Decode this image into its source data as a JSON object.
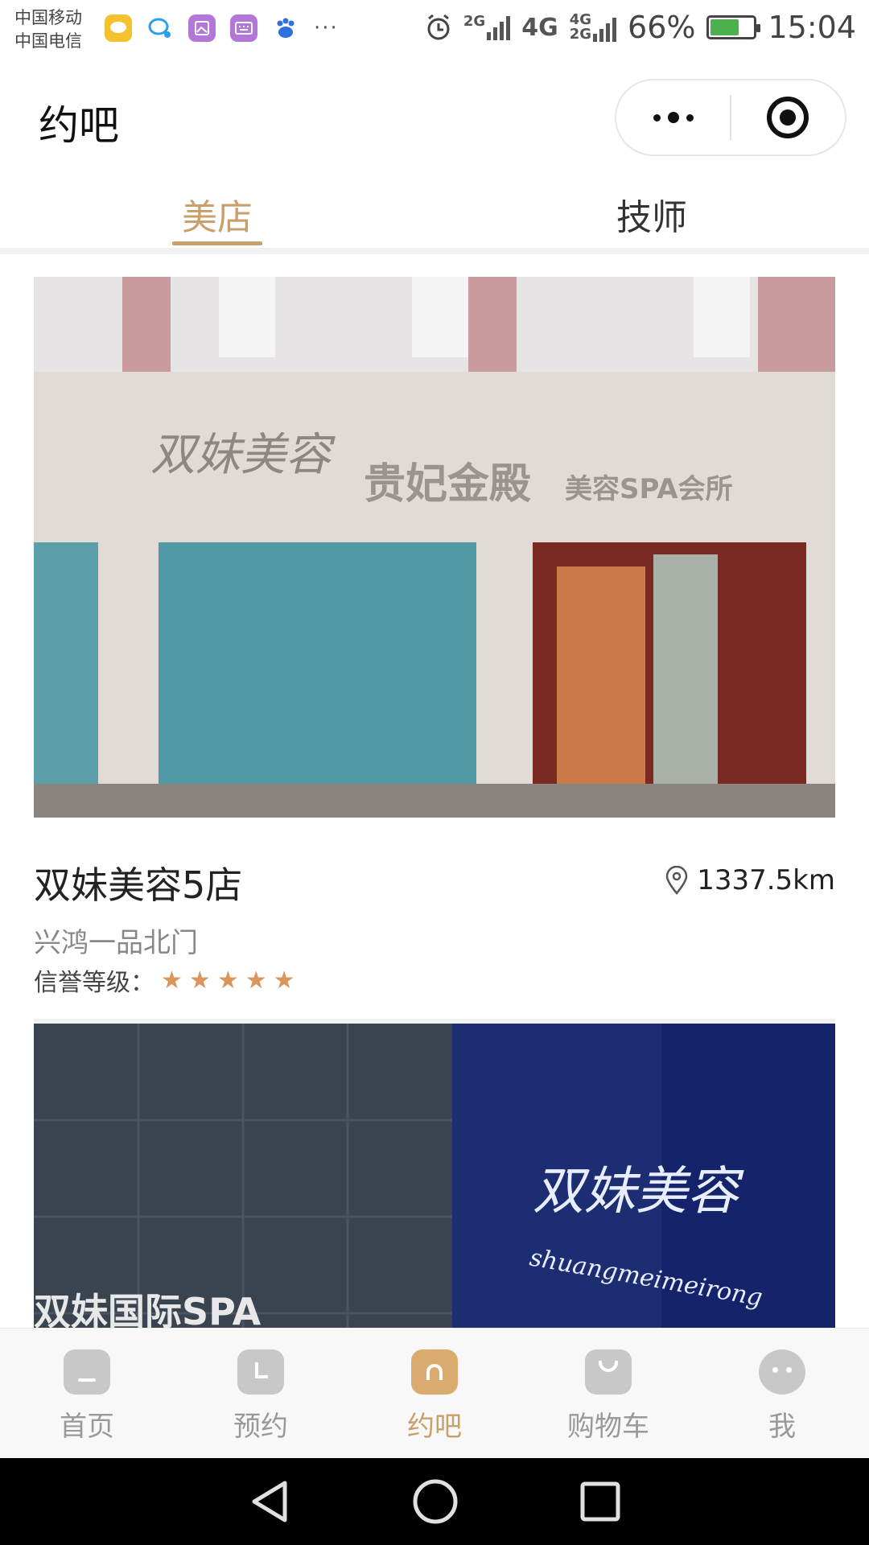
{
  "status_bar": {
    "carrier_1": "中国移动",
    "carrier_2": "中国电信",
    "notif_more": "···",
    "net_2g": "2G",
    "net_4g": "4G",
    "net_4g_small": "4G",
    "net_2g_small": "2G",
    "battery_percent": "66%",
    "battery_level": 0.66,
    "time": "15:04"
  },
  "header": {
    "title": "约吧"
  },
  "tabs": [
    {
      "label": "美店",
      "active": true
    },
    {
      "label": "技师",
      "active": false
    }
  ],
  "shops": [
    {
      "name": "双妹美容5店",
      "distance": "1337.5km",
      "address": "兴鸿一品北门",
      "credit_label": "信誉等级：",
      "stars": 5,
      "sign_logo": "双妹美容",
      "sign_main": "贵妃金殿",
      "sign_sub": "美容SPA会所"
    },
    {
      "sign_logo": "双妹美容",
      "sign_script": "shuangmeimeirong",
      "sign_left": "双妹国际SPA"
    }
  ],
  "tabbar": [
    {
      "label": "首页",
      "active": false
    },
    {
      "label": "预约",
      "active": false
    },
    {
      "label": "约吧",
      "active": true
    },
    {
      "label": "购物车",
      "active": false
    },
    {
      "label": "我",
      "active": false
    }
  ],
  "colors": {
    "accent": "#c9a06a",
    "star": "#d9955b",
    "tabbar_bg": "#f8f8f8"
  }
}
